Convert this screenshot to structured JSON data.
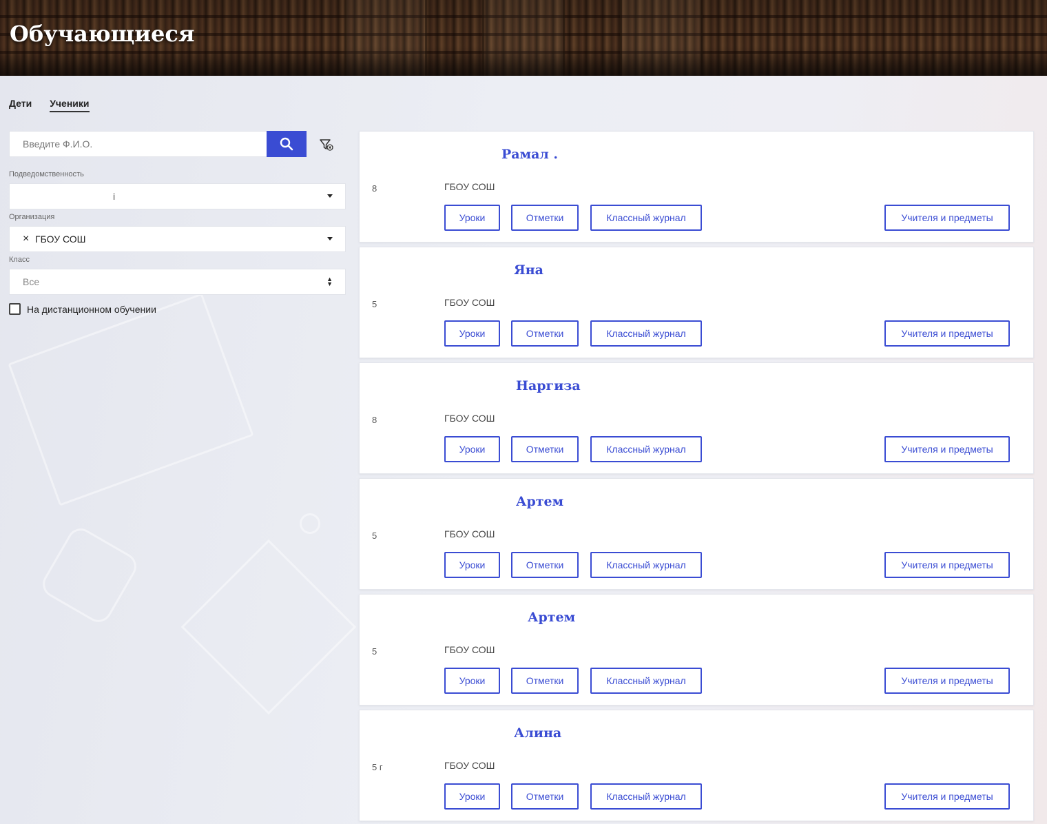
{
  "header": {
    "title": "Обучающиеся"
  },
  "tabs": [
    {
      "label": "Дети",
      "active": false
    },
    {
      "label": "Ученики",
      "active": true
    }
  ],
  "search": {
    "placeholder": "Введите Ф.И.О.",
    "value": ""
  },
  "filters": {
    "subordination": {
      "label": "Подведомственность",
      "value": "i"
    },
    "organization": {
      "label": "Организация",
      "value": "ГБОУ СОШ",
      "clear_icon": "×"
    },
    "class": {
      "label": "Класс",
      "value": "Все"
    },
    "distance_learning": {
      "label": "На дистанционном обучении",
      "checked": false
    }
  },
  "button_labels": {
    "lessons": "Уроки",
    "marks": "Отметки",
    "journal": "Классный журнал",
    "teachers": "Учителя и предметы"
  },
  "students": [
    {
      "name": "Рамал .",
      "grade": "8",
      "org": "ГБОУ СОШ"
    },
    {
      "name": "Яна",
      "grade": "5",
      "org": "ГБОУ СОШ"
    },
    {
      "name": "Наргиза",
      "grade": "8",
      "org": "ГБОУ СОШ"
    },
    {
      "name": "Артем",
      "grade": "5",
      "org": "ГБОУ СОШ"
    },
    {
      "name": "Артем",
      "grade": "5",
      "org": "ГБОУ СОШ"
    },
    {
      "name": "Алина",
      "grade": "5 г",
      "org": "ГБОУ СОШ"
    }
  ],
  "colors": {
    "accent": "#3a4cd3"
  },
  "icons": {
    "search": "search-icon",
    "filter": "filter-clear-icon",
    "dropdown": "chevron-down-icon"
  }
}
